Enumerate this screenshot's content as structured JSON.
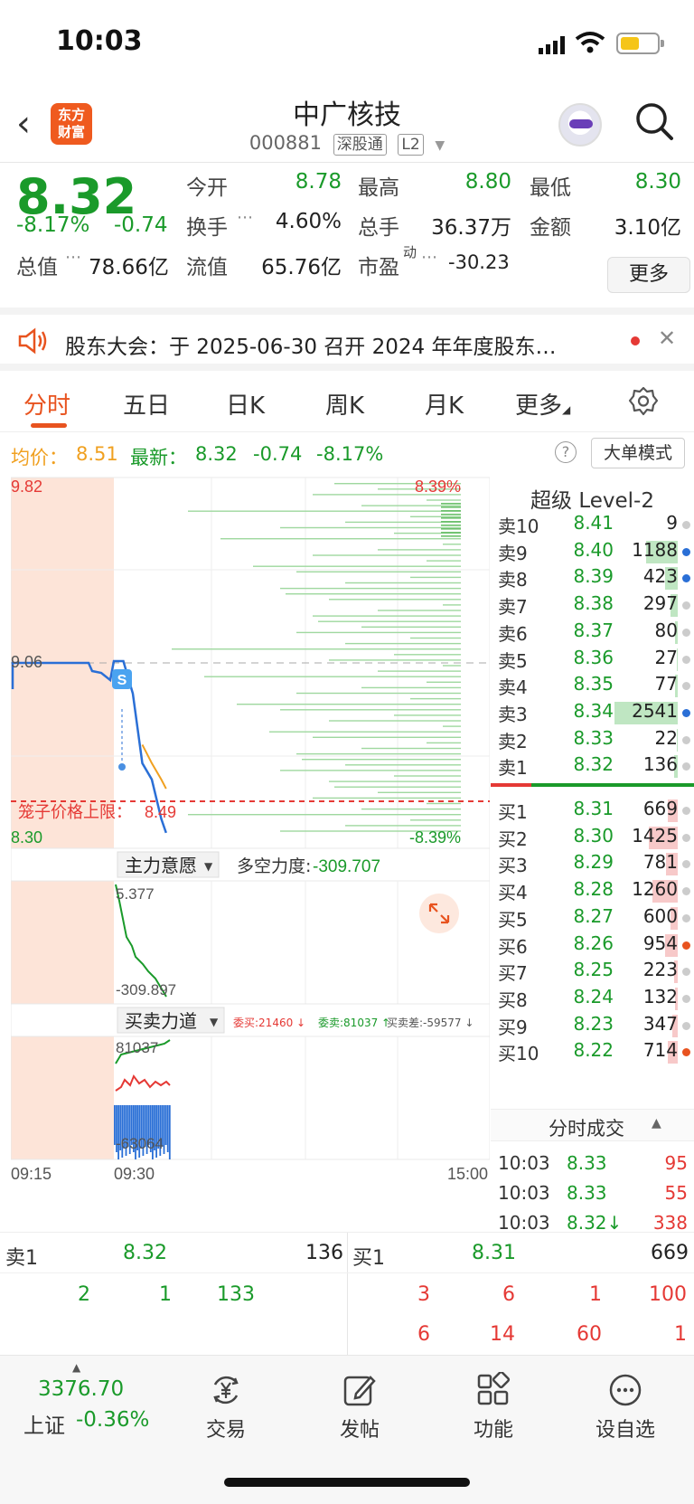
{
  "status": {
    "time": "10:03"
  },
  "header": {
    "back": "‹",
    "logo_line1": "东方",
    "logo_line2": "财富",
    "title": "中广核技",
    "code": "000881",
    "tag1": "深股通",
    "tag2": "L2"
  },
  "quote": {
    "price": "8.32",
    "change_pct": "-8.17%",
    "change": "-0.74",
    "open_label": "今开",
    "open": "8.78",
    "high_label": "最高",
    "high": "8.80",
    "low_label": "最低",
    "low": "8.30",
    "turnover_label": "换手",
    "turnover": "4.60%",
    "volume_label": "总手",
    "volume": "36.37万",
    "amount_label": "金额",
    "amount": "3.10亿",
    "mktcap_label": "总值",
    "mktcap": "78.66亿",
    "float_label": "流值",
    "float": "65.76亿",
    "pe_label": "市盈",
    "pe_sup": "动",
    "pe": "-30.23",
    "more": "更多"
  },
  "notice": {
    "text": "股东大会：于 2025-06-30 召开 2024 年年度股东…"
  },
  "tabs": [
    "分时",
    "五日",
    "日K",
    "周K",
    "月K",
    "更多"
  ],
  "infobar": {
    "avg_label": "均价：",
    "avg": "8.51",
    "latest_label": "最新：",
    "latest": "8.32",
    "chg": "-0.74",
    "pct": "-8.17%",
    "mode": "大单模式"
  },
  "chart": {
    "y_top": "9.82",
    "y_mid": "9.06",
    "y_bot": "8.30",
    "pct_top": "8.39%",
    "pct_bot": "-8.39%",
    "cage_label": "笼子价格上限：",
    "cage_value": "8.49",
    "ind1_name": "主力意愿",
    "ind1_label": "多空力度:",
    "ind1_value": "-309.707",
    "ind1_top": "5.377",
    "ind1_bot": "-309.897",
    "ind2_name": "买卖力道",
    "ind2_wm": "委买:21460 ↓",
    "ind2_ws": "委卖:81037 ↑",
    "ind2_diff": "买卖差:-59577 ↓",
    "ind2_top": "81037",
    "ind2_bot": "-63064",
    "t_start": "09:15",
    "t_mid": "09:30",
    "t_end": "15:00"
  },
  "chart_data": {
    "type": "line",
    "title": "",
    "series": [
      {
        "name": "最新",
        "x": [
          "09:30",
          "09:36",
          "09:42",
          "09:48",
          "09:54",
          "10:00",
          "10:03"
        ],
        "values": [
          9.06,
          9.06,
          8.92,
          8.62,
          8.55,
          8.38,
          8.32
        ]
      },
      {
        "name": "均价",
        "x": [
          "09:48",
          "09:54",
          "10:00",
          "10:03"
        ],
        "values": [
          8.7,
          8.62,
          8.55,
          8.51
        ]
      }
    ],
    "ylim": [
      8.3,
      9.82
    ],
    "reference": 9.06,
    "xlabel": "",
    "ylabel": "",
    "x_ticks": [
      "09:15",
      "09:30",
      "15:00"
    ]
  },
  "orderbook": {
    "title": "超级 Level-2",
    "asks": [
      {
        "k": "卖10",
        "p": "8.41",
        "v": "9",
        "dot": "#ccc",
        "bar": 0
      },
      {
        "k": "卖9",
        "p": "8.40",
        "v": "1188",
        "dot": "#2a6fd6",
        "bar": 0.5
      },
      {
        "k": "卖8",
        "p": "8.39",
        "v": "423",
        "dot": "#2a6fd6",
        "bar": 0.2
      },
      {
        "k": "卖7",
        "p": "8.38",
        "v": "297",
        "dot": "#ccc",
        "bar": 0.12
      },
      {
        "k": "卖6",
        "p": "8.37",
        "v": "80",
        "dot": "#ccc",
        "bar": 0.04
      },
      {
        "k": "卖5",
        "p": "8.36",
        "v": "27",
        "dot": "#ccc",
        "bar": 0.02
      },
      {
        "k": "卖4",
        "p": "8.35",
        "v": "77",
        "dot": "#ccc",
        "bar": 0.04
      },
      {
        "k": "卖3",
        "p": "8.34",
        "v": "2541",
        "dot": "#2a6fd6",
        "bar": 1
      },
      {
        "k": "卖2",
        "p": "8.33",
        "v": "22",
        "dot": "#ccc",
        "bar": 0.02
      },
      {
        "k": "卖1",
        "p": "8.32",
        "v": "136",
        "dot": "#ccc",
        "bar": 0.06
      }
    ],
    "bids": [
      {
        "k": "买1",
        "p": "8.31",
        "v": "669",
        "dot": "#ccc",
        "bar": 0.15
      },
      {
        "k": "买2",
        "p": "8.30",
        "v": "1425",
        "dot": "#ccc",
        "bar": 0.45
      },
      {
        "k": "买3",
        "p": "8.29",
        "v": "781",
        "dot": "#ccc",
        "bar": 0.18
      },
      {
        "k": "买4",
        "p": "8.28",
        "v": "1260",
        "dot": "#ccc",
        "bar": 0.4
      },
      {
        "k": "买5",
        "p": "8.27",
        "v": "600",
        "dot": "#ccc",
        "bar": 0.12
      },
      {
        "k": "买6",
        "p": "8.26",
        "v": "954",
        "dot": "#e8531f",
        "bar": 0.2
      },
      {
        "k": "买7",
        "p": "8.25",
        "v": "223",
        "dot": "#ccc",
        "bar": 0.06
      },
      {
        "k": "买8",
        "p": "8.24",
        "v": "132",
        "dot": "#ccc",
        "bar": 0.04
      },
      {
        "k": "买9",
        "p": "8.23",
        "v": "347",
        "dot": "#ccc",
        "bar": 0.08
      },
      {
        "k": "买10",
        "p": "8.22",
        "v": "714",
        "dot": "#e8531f",
        "bar": 0.15
      }
    ],
    "ticks_title": "分时成交",
    "ticks": [
      {
        "t": "10:03",
        "p": "8.33",
        "v": "95"
      },
      {
        "t": "10:03",
        "p": "8.33",
        "v": "55"
      },
      {
        "t": "10:03",
        "p": "8.32↓",
        "v": "338"
      }
    ]
  },
  "bottom_queue": {
    "sell_label": "卖1",
    "sell_price": "8.32",
    "sell_vol": "136",
    "buy_label": "买1",
    "buy_price": "8.31",
    "buy_vol": "669",
    "sell_orders": [
      "2",
      "1",
      "133"
    ],
    "buy_orders_row1": [
      "3",
      "6",
      "1",
      "100"
    ],
    "buy_orders_row2": [
      "6",
      "14",
      "60",
      "1"
    ]
  },
  "nav": {
    "index_value": "3376.70",
    "index_name": "上证",
    "index_pct": "-0.36%",
    "items": [
      "交易",
      "发帖",
      "功能",
      "设自选"
    ]
  }
}
